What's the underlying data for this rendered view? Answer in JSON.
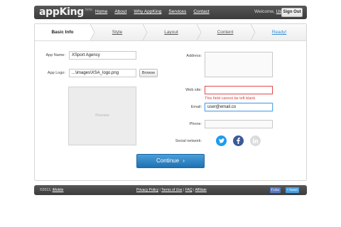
{
  "header": {
    "logo_text": "appKing",
    "logo_badge": "beta",
    "nav": [
      "Home",
      "About",
      "Why AppKing",
      "Services",
      "Contact"
    ],
    "welcome_prefix": "Welcome,",
    "username": "Username",
    "signout_label": "Sign Out"
  },
  "steps": [
    "Basic Info",
    "Style",
    "Layout",
    "Content",
    "Ready!"
  ],
  "form": {
    "app_name_label": "App Name:",
    "app_name_value": "XSport Agency",
    "app_logo_label": "App Logo:",
    "app_logo_value": "...\\images\\XSA_logo.png",
    "browse_label": "Browse",
    "preview_label": "Preview",
    "address_label": "Address:",
    "website_label": "Web site:",
    "website_error": "This field cannot be left blank",
    "email_label": "Email:",
    "email_value": "user@email.co",
    "phone_label": "Phone:",
    "social_label": "Social network:",
    "continue_label": "Continue"
  },
  "social": [
    {
      "name": "twitter-icon",
      "color": "#1d9bf0"
    },
    {
      "name": "facebook-icon",
      "color": "#3b5998"
    },
    {
      "name": "linkedin-icon",
      "color": "#d9d9d9"
    }
  ],
  "footer": {
    "copyright": "©2013,",
    "company": "iMobile",
    "links": [
      "Privacy Policy",
      "Terms of Use",
      "FAQ",
      "Affiliate"
    ],
    "like_label": "Like",
    "tweet_label": "Tweet"
  },
  "colors": {
    "accent": "#2b82c4",
    "error": "#e03c3c",
    "bar": "#474747"
  }
}
